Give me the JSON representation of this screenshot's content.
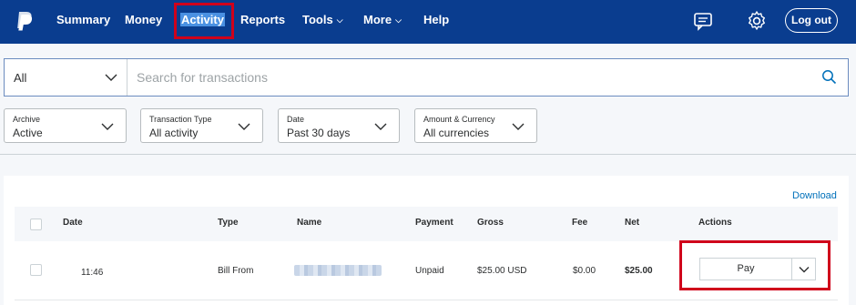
{
  "nav": {
    "items": [
      {
        "label": "Summary"
      },
      {
        "label": "Money"
      },
      {
        "label": "Activity"
      },
      {
        "label": "Reports"
      },
      {
        "label": "Tools"
      },
      {
        "label": "More"
      },
      {
        "label": "Help"
      }
    ],
    "logout_label": "Log out"
  },
  "search": {
    "type_value": "All",
    "placeholder": "Search for transactions"
  },
  "filters": [
    {
      "label": "Archive",
      "value": "Active"
    },
    {
      "label": "Transaction Type",
      "value": "All activity"
    },
    {
      "label": "Date",
      "value": "Past 30 days"
    },
    {
      "label": "Amount & Currency",
      "value": "All currencies"
    }
  ],
  "activity": {
    "download_label": "Download",
    "columns": [
      "Date",
      "Type",
      "Name",
      "Payment",
      "Gross",
      "Fee",
      "Net",
      "Actions"
    ],
    "rows": [
      {
        "date": "11:46",
        "type": "Bill From",
        "payment": "Unpaid",
        "gross": "$25.00 USD",
        "fee": "$0.00",
        "net": "$25.00",
        "action_label": "Pay"
      }
    ]
  },
  "colors": {
    "nav_bg": "#0a3d8f",
    "highlight": "#d0021b",
    "link": "#0070ba"
  }
}
